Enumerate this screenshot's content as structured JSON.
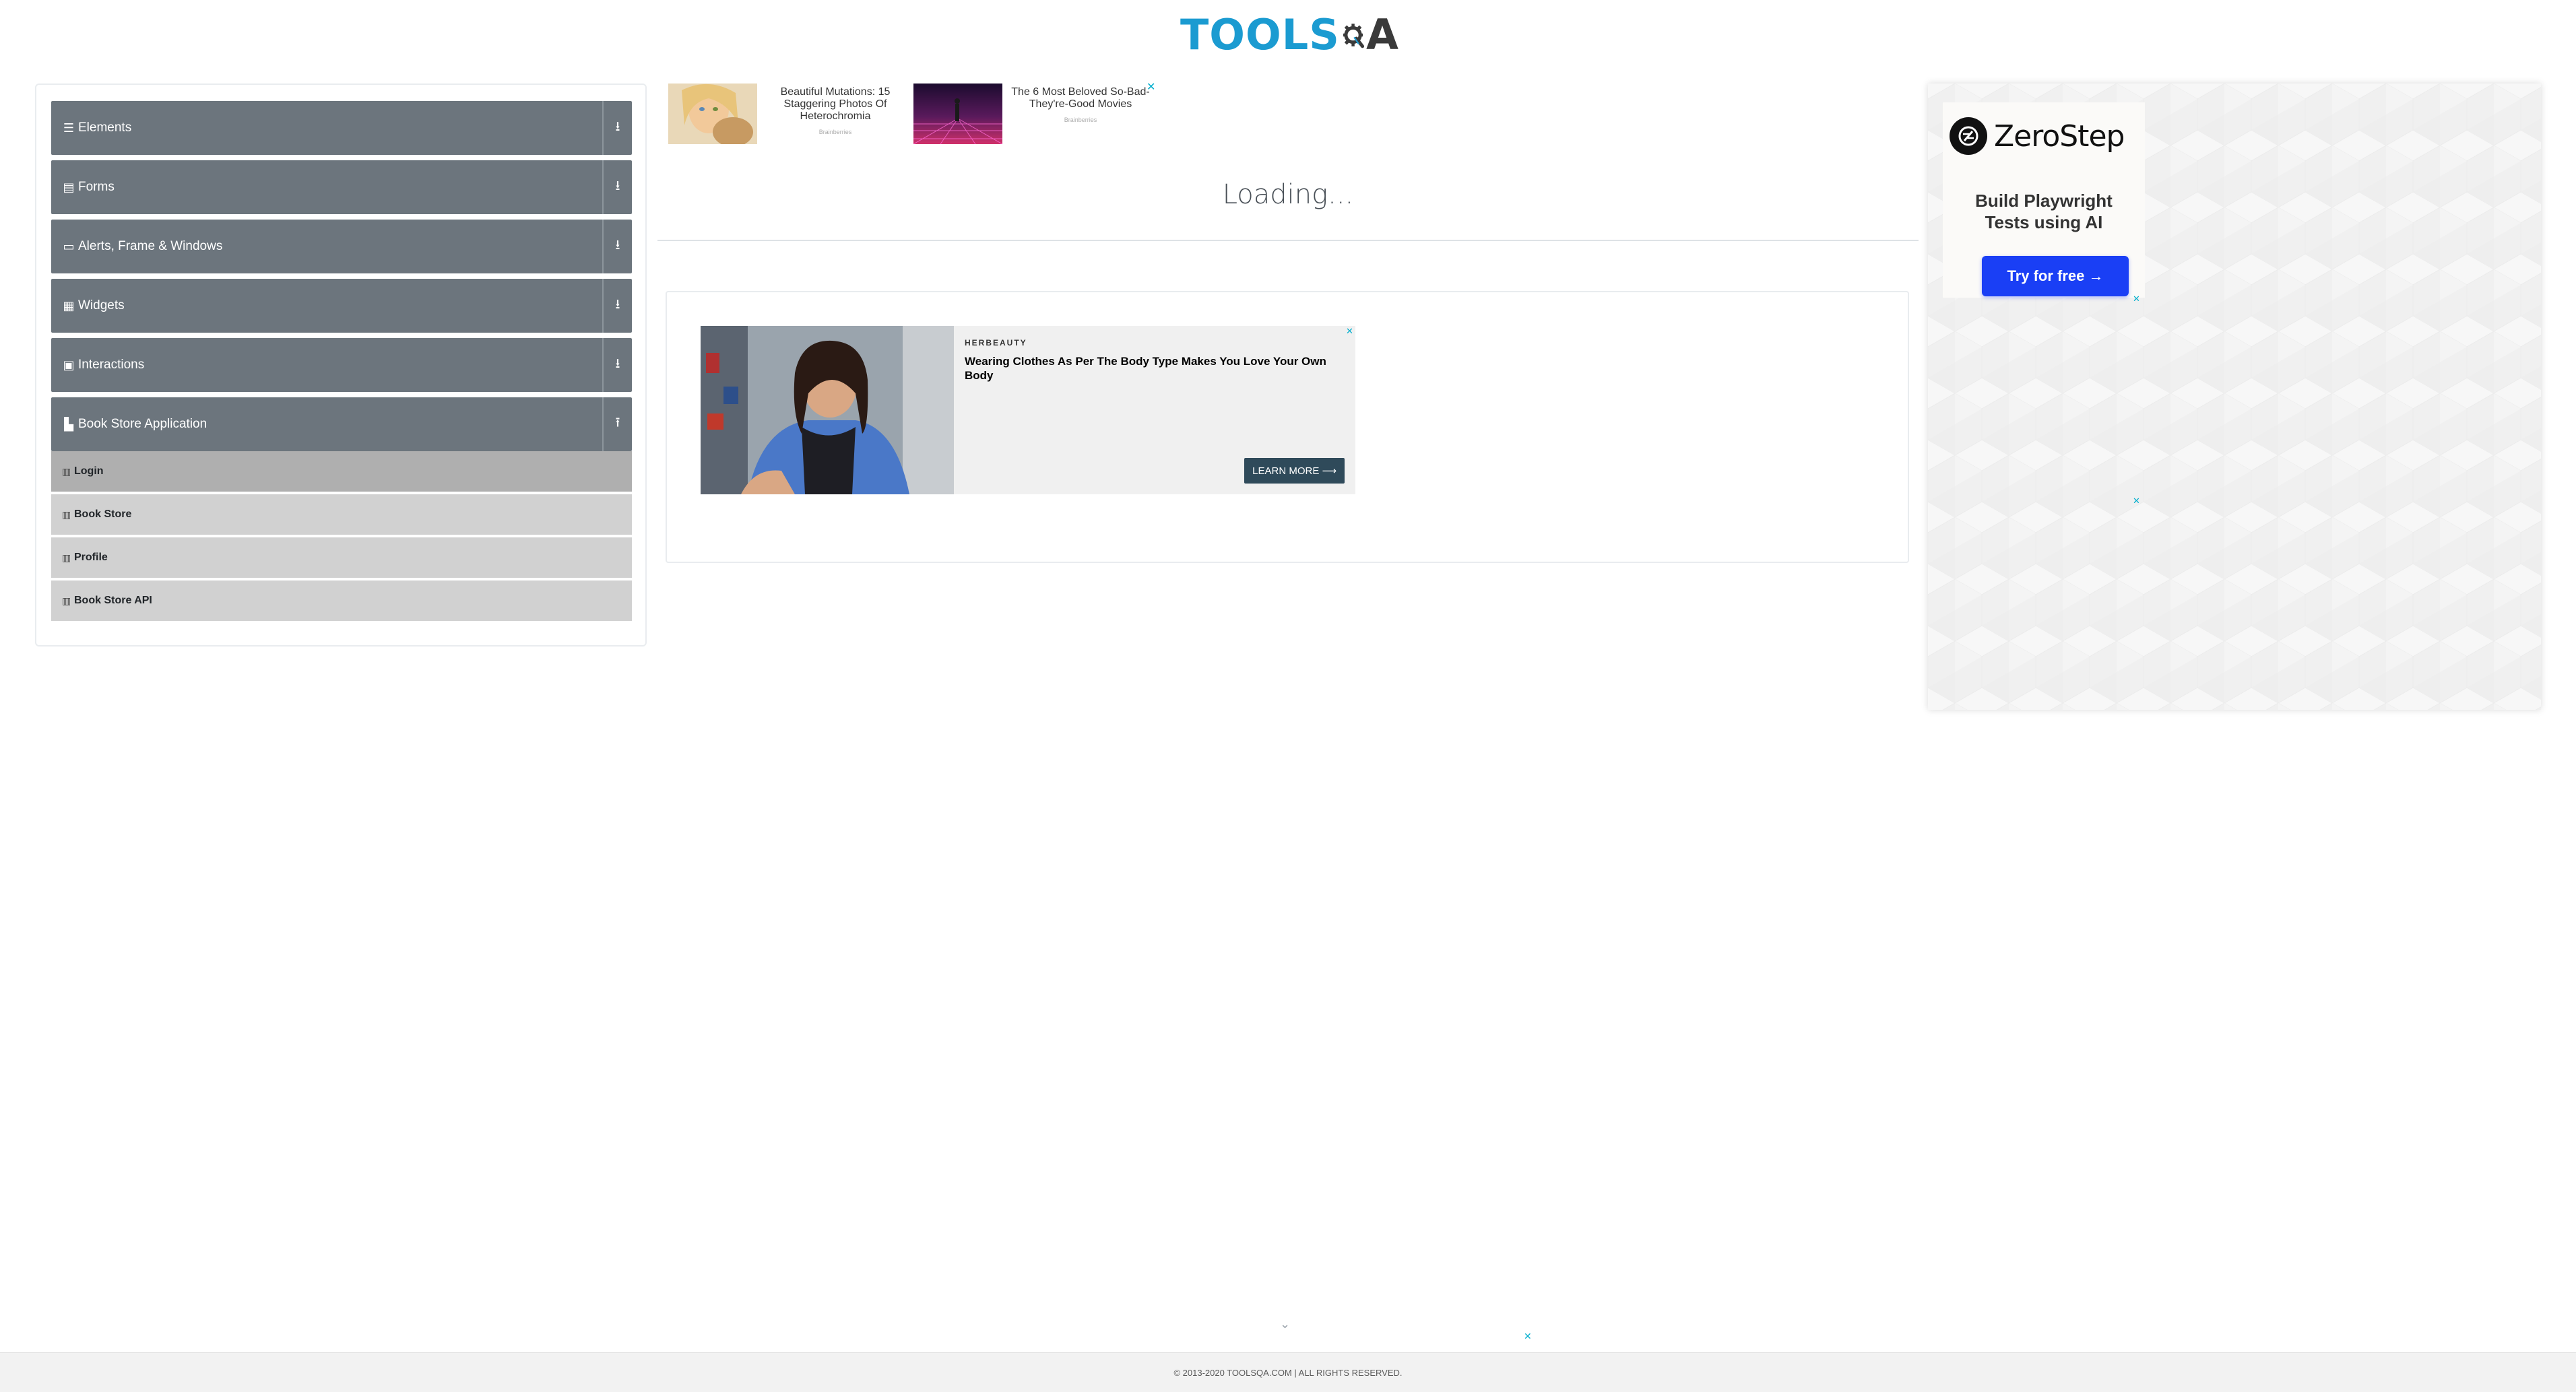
{
  "header": {
    "logo_text": "TOOLS",
    "logo_suffix": "A"
  },
  "sidebar": {
    "groups": [
      {
        "label": "Elements",
        "icon": "list-icon",
        "glyph": "☰",
        "arrow": "⭳"
      },
      {
        "label": "Forms",
        "icon": "document-icon",
        "glyph": "▤",
        "arrow": "⭳"
      },
      {
        "label": "Alerts, Frame & Windows",
        "icon": "window-icon",
        "glyph": "▭",
        "arrow": "⭳"
      },
      {
        "label": "Widgets",
        "icon": "grid-icon",
        "glyph": "▦",
        "arrow": "⭳"
      },
      {
        "label": "Interactions",
        "icon": "interaction-icon",
        "glyph": "▣",
        "arrow": "⭳"
      },
      {
        "label": "Book Store Application",
        "icon": "book-icon",
        "glyph": "▙",
        "arrow": "⭱"
      }
    ],
    "book_store_items": [
      {
        "label": "Login",
        "glyph": "▥"
      },
      {
        "label": "Book Store",
        "glyph": "▥"
      },
      {
        "label": "Profile",
        "glyph": "▥"
      },
      {
        "label": "Book Store API",
        "glyph": "▥"
      }
    ]
  },
  "top_ads": [
    {
      "text": "Beautiful Mutations: 15 Staggering Photos Of Heterochromia",
      "source": "Brainberries"
    },
    {
      "text": "The 6 Most Beloved So-Bad-They're-Good Movies",
      "source": "Brainberries"
    }
  ],
  "main": {
    "loading_text": "Loading..."
  },
  "mid_ad": {
    "brand": "HERBEAUTY",
    "headline": "Wearing Clothes As Per The Body Type Makes You Love Your Own Body",
    "cta": "LEARN MORE ⟶"
  },
  "right_ad": {
    "brand": "ZeroStep",
    "tagline_line1": "Build Playwright",
    "tagline_line2": "Tests using AI",
    "cta": "Try for free →"
  },
  "close_glyph": "✕",
  "chevron_glyph": "⌄",
  "footer": {
    "text": "© 2013-2020 TOOLSQA.COM | ALL RIGHTS RESERVED."
  },
  "colors": {
    "brand_blue": "#1b9bd1",
    "sidebar_group_bg": "#6c757d",
    "menu_item_bg": "#d1d1d1",
    "menu_item_active_bg": "#afafaf",
    "zerostep_button": "#1a3ff5"
  }
}
